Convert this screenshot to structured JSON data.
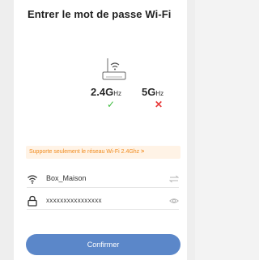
{
  "page": {
    "title": "Entrer le mot de passe Wi-Fi"
  },
  "router_icon": "wifi-router-icon",
  "bands": [
    {
      "label": "2.4G",
      "unit": "Hz",
      "supported": true,
      "status_icon": "check-icon"
    },
    {
      "label": "5G",
      "unit": "Hz",
      "supported": false,
      "status_icon": "cross-icon"
    }
  ],
  "status_symbols": {
    "check": "✓",
    "cross": "✕"
  },
  "notice": {
    "text": "Supporte seulement le réseau Wi-Fi 2.4Ghz",
    "arrow": ">"
  },
  "ssid_field": {
    "icon": "wifi-icon",
    "value": "Box_Maison",
    "action_icon": "switch-arrows-icon"
  },
  "password_field": {
    "icon": "lock-icon",
    "value": "xxxxxxxxxxxxxxxx",
    "action_icon": "eye-icon"
  },
  "confirm_button": {
    "label": "Confirmer"
  },
  "colors": {
    "accent": "#5b87c9",
    "success": "#3dbb3d",
    "error": "#e83b3b",
    "warning": "#f08a1c"
  }
}
